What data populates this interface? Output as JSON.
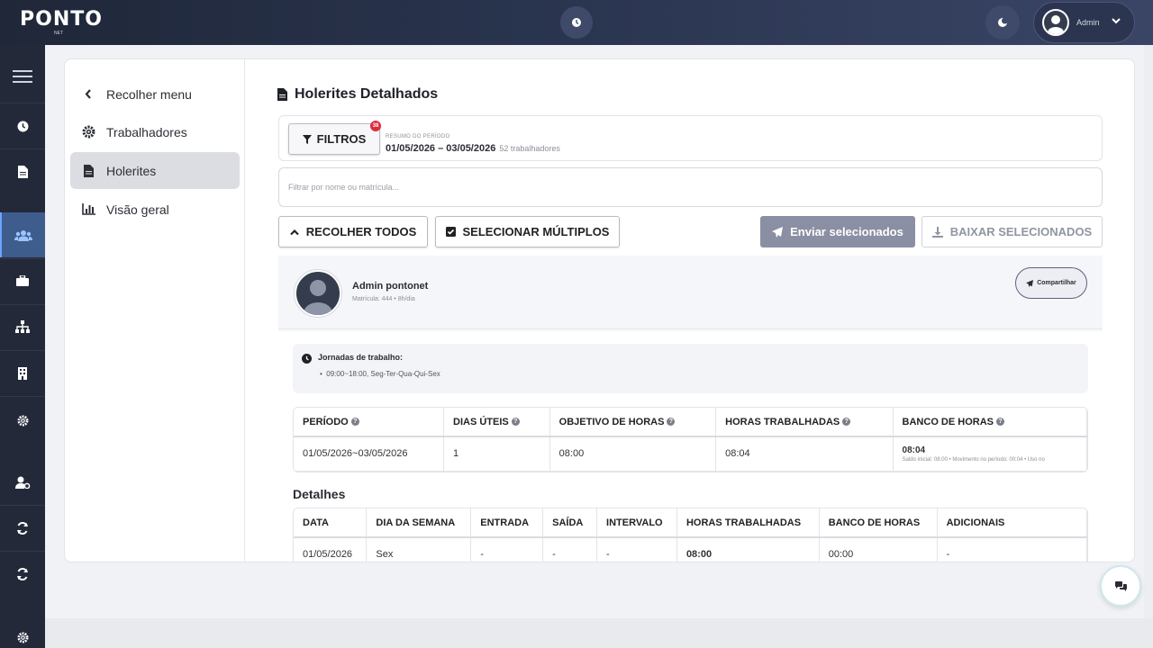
{
  "app": {
    "logo": "PONTO",
    "logo_sub": "NET"
  },
  "topbar": {
    "user_name": "Admin"
  },
  "side_menu": {
    "items": [
      {
        "label": "Recolher menu"
      },
      {
        "label": "Trabalhadores"
      },
      {
        "label": "Holerites"
      },
      {
        "label": "Visão geral"
      }
    ]
  },
  "page": {
    "title": "Holerites Detalhados"
  },
  "filters": {
    "button_label": "FILTROS",
    "badge": "38",
    "summary_label": "RESUMO DO PERÍODO",
    "period": "01/05/2026 – 03/05/2026",
    "count": "52 trabalhadores"
  },
  "search": {
    "placeholder": "Filtrar por nome ou matrícula..."
  },
  "actions": {
    "collapse_all": "RECOLHER TODOS",
    "select_multiple": "SELECIONAR MÚLTIPLOS",
    "send_selected": "Enviar selecionados",
    "download_selected": "BAIXAR SELECIONADOS"
  },
  "worker": {
    "name": "Admin pontonet",
    "sub": "Matrícula: 444 • 8h/dia",
    "share": "Compartilhar",
    "jornada_title": "Jornadas de trabalho:",
    "jornada_item": "09:00~18:00, Seg-Ter-Qua-Qui-Sex"
  },
  "summary_table": {
    "headers": [
      "PERÍODO",
      "DIAS ÚTEIS",
      "OBJETIVO DE HORAS",
      "HORAS TRABALHADAS",
      "BANCO DE HORAS"
    ],
    "row": [
      "01/05/2026~03/05/2026",
      "1",
      "08:00",
      "08:04",
      "08:04"
    ],
    "banco_sub": "Saldo inicial: 08:00 • Movimento no período: 00:04 • Uso no"
  },
  "details": {
    "title": "Detalhes",
    "headers": [
      "DATA",
      "DIA DA SEMANA",
      "ENTRADA",
      "SAÍDA",
      "INTERVALO",
      "HORAS TRABALHADAS",
      "BANCO DE HORAS",
      "ADICIONAIS"
    ],
    "rows": [
      [
        "01/05/2026",
        "Sex",
        "-",
        "-",
        "-",
        "08:00",
        "00:00",
        "-"
      ]
    ]
  },
  "colors": {
    "accent": "#3e5c8c",
    "badge": "#e02b3c",
    "send_button": "#8a8fa3"
  }
}
